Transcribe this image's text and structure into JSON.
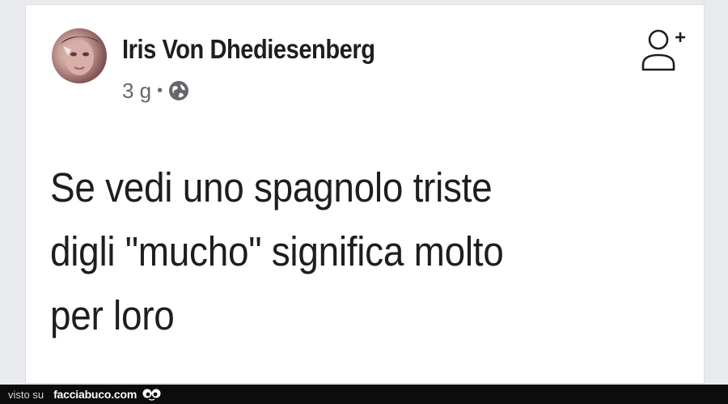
{
  "post": {
    "author_name": "Iris Von Dhediesenberg",
    "timestamp": "3 g",
    "separator": "•",
    "privacy_icon": "globe-icon",
    "add_friend_icon": "add-friend-icon",
    "text": "Se vedi uno spagnolo triste\ndigli \"mucho\" significa molto\nper loro"
  },
  "footer": {
    "visto_su": "visto su",
    "site_name": "facciabuco.com",
    "logo_icon": "eyes-logo-icon"
  },
  "colors": {
    "background": "#e9eaed",
    "card": "#ffffff",
    "text_primary": "#1c1e21",
    "text_secondary": "#65676b",
    "footer_bar": "#0c0c0c"
  }
}
